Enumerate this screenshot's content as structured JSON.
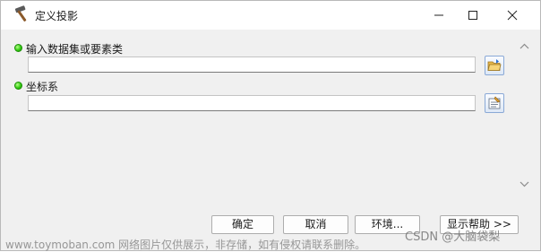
{
  "window": {
    "title": "定义投影",
    "icon": "hammer-icon"
  },
  "fields": [
    {
      "label": "输入数据集或要素类",
      "value": "",
      "button_icon": "open-folder-icon"
    },
    {
      "label": "坐标系",
      "value": "",
      "button_icon": "properties-icon"
    }
  ],
  "buttons": {
    "ok": "确定",
    "cancel": "取消",
    "environments": "环境...",
    "show_help": "显示帮助 >>"
  },
  "watermarks": {
    "left": "www.toymoban.com 网络图片仅供展示，非存储，如有侵权请联系删除。",
    "right": "CSDN @大脑袋梨"
  },
  "colors": {
    "required_dot": "#33cc11",
    "dialog_bg": "#f0f0f0"
  }
}
